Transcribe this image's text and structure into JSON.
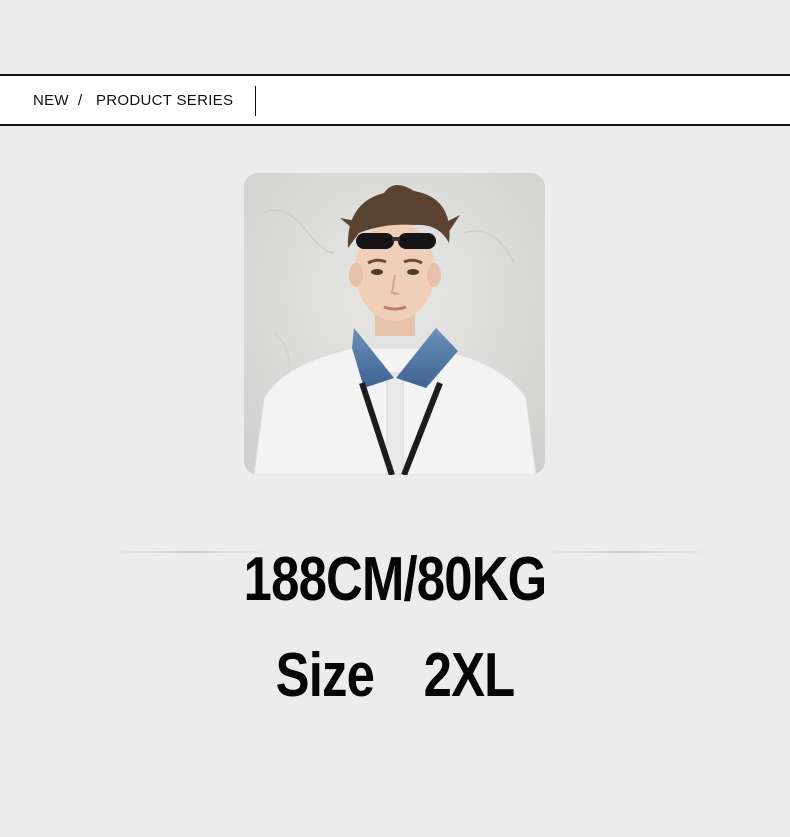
{
  "breadcrumb": {
    "new_label": "NEW",
    "separator": "/",
    "series_label": "PRODUCT SERIES"
  },
  "model": {
    "height_weight": "188CM/80KG",
    "size": "Size  2XL"
  },
  "colors": {
    "background": "#ececec",
    "bar": "#ffffff",
    "text": "#050505"
  }
}
